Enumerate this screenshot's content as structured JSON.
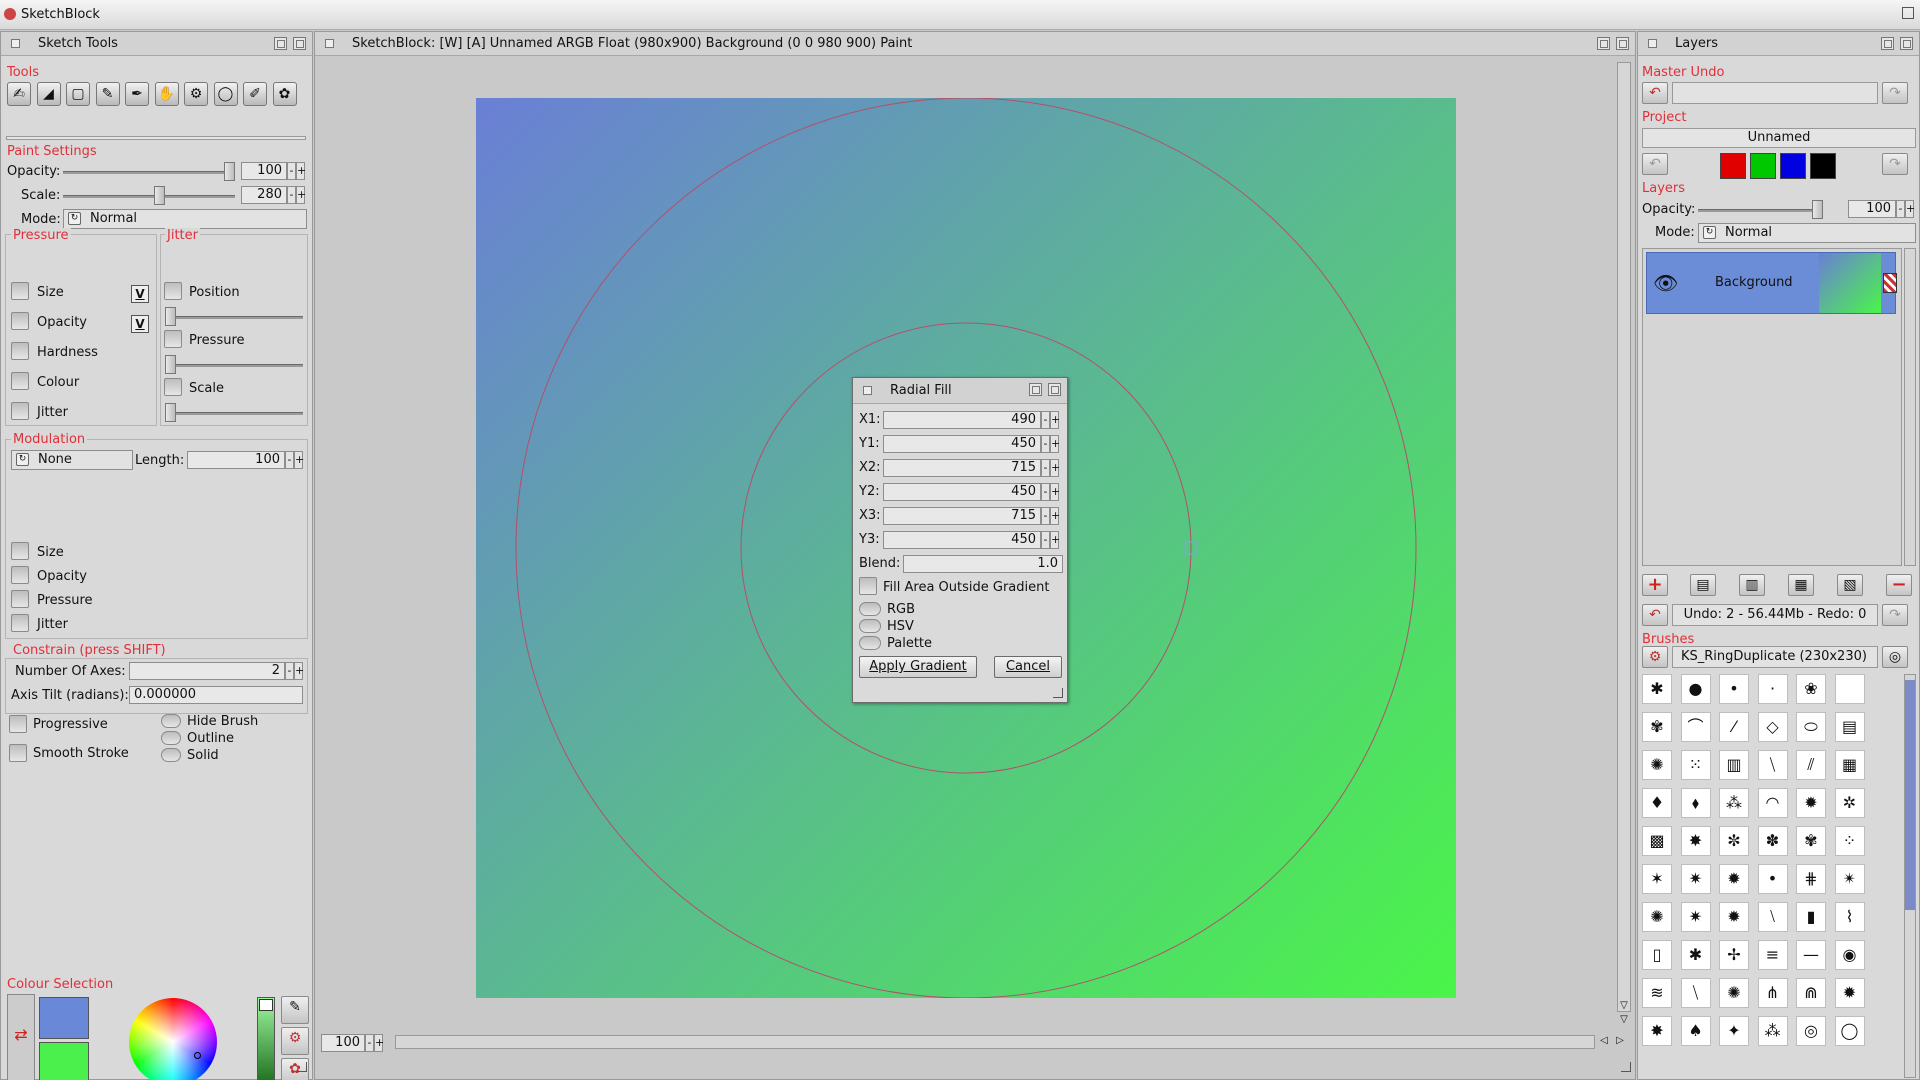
{
  "window": {
    "title": "SketchBlock"
  },
  "sketch_tools": {
    "title": "Sketch Tools",
    "tools_label": "Tools",
    "tools": [
      "smudge-tool",
      "gradient-tool",
      "select-tool",
      "pipette-tool",
      "pen-tool",
      "hand-tool",
      "transform-tool",
      "ring-tool",
      "eraser-tool",
      "palette-tool"
    ],
    "paint_settings_label": "Paint Settings",
    "opacity_label": "Opacity:",
    "opacity_value": "100",
    "scale_label": "Scale:",
    "scale_value": "280",
    "mode_label": "Mode:",
    "mode_value": "Normal",
    "pressure_label": "Pressure",
    "pressure_items": [
      "Size",
      "Opacity",
      "Hardness",
      "Colour",
      "Jitter"
    ],
    "v_label": "V",
    "jitter_label": "Jitter",
    "jitter_items": [
      "Position",
      "Pressure",
      "Scale"
    ],
    "modulation_label": "Modulation",
    "modulation_value": "None",
    "length_label": "Length:",
    "length_value": "100",
    "mod_items": [
      "Size",
      "Opacity",
      "Pressure",
      "Jitter"
    ],
    "constrain_label": "Constrain (press SHIFT)",
    "axes_label": "Number Of Axes:",
    "axes_value": "2",
    "tilt_label": "Axis Tilt (radians):",
    "tilt_value": "0.000000",
    "progressive_label": "Progressive",
    "smooth_label": "Smooth Stroke",
    "hide_brush_label": "Hide Brush",
    "outline_label": "Outline",
    "solid_label": "Solid",
    "colour_selection_label": "Colour Selection",
    "primary_color": "#6a88d8",
    "secondary_color": "#4cf04c"
  },
  "canvas": {
    "title": "SketchBlock: [W] [A]  Unnamed   ARGB Float (980x900) Background (0 0 980 900) Paint",
    "zoom_value": "100",
    "gradient_start": "#6a7fd6",
    "gradient_end": "#4af549"
  },
  "radial_fill": {
    "title": "Radial Fill",
    "fields": [
      {
        "label": "X1:",
        "value": "490"
      },
      {
        "label": "Y1:",
        "value": "450"
      },
      {
        "label": "X2:",
        "value": "715"
      },
      {
        "label": "Y2:",
        "value": "450"
      },
      {
        "label": "X3:",
        "value": "715"
      },
      {
        "label": "Y3:",
        "value": "450"
      }
    ],
    "blend_label": "Blend:",
    "blend_value": "1.0",
    "fill_outside_label": "Fill Area Outside Gradient",
    "modes": [
      "RGB",
      "HSV",
      "Palette"
    ],
    "apply_label": "Apply Gradient",
    "cancel_label": "Cancel"
  },
  "layers": {
    "title": "Layers",
    "master_undo_label": "Master Undo",
    "project_label": "Project",
    "project_name": "Unnamed",
    "swatches": [
      "#e00000",
      "#00c800",
      "#0000e0",
      "#000000"
    ],
    "layers_label": "Layers",
    "opacity_label": "Opacity:",
    "opacity_value": "100",
    "mode_label": "Mode:",
    "mode_value": "Normal",
    "layer_name": "Background",
    "undo_status": "Undo: 2 - 56.44Mb - Redo: 0",
    "brushes_label": "Brushes",
    "brush_name": "KS_RingDuplicate (230x230)",
    "brush_glyphs": [
      "✱",
      "●",
      "•",
      "·",
      "❀",
      " ",
      "✾",
      "⌒",
      "⁄",
      "◇",
      "⬭",
      "▤",
      "✺",
      "⁙",
      "▥",
      "⧹",
      "⫽",
      "▦",
      "♦",
      "⬧",
      "⁂",
      "◠",
      "✹",
      "✲",
      "▩",
      "✸",
      "✼",
      "✽",
      "✾",
      "⁘",
      "✶",
      "✷",
      "✹",
      "•",
      "⋕",
      "✴",
      "✺",
      "✷",
      "✹",
      "⧵",
      "▮",
      "⌇",
      "▯",
      "✱",
      "✢",
      "≡",
      "—",
      "◉",
      "≋",
      "⧹",
      "✺",
      "⋔",
      "⋒",
      "✹",
      "✸",
      "♠",
      "✦",
      "⁂",
      "◎",
      "◯"
    ]
  }
}
